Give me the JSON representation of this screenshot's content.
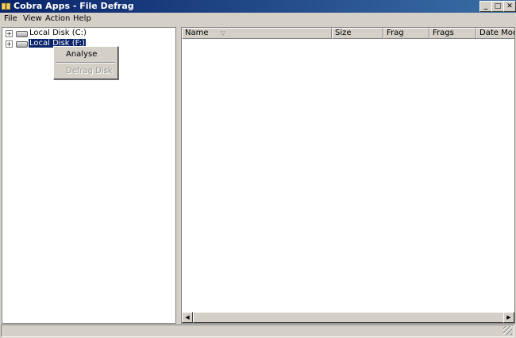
{
  "window": {
    "title": "Cobra Apps - File Defrag",
    "icon": "app-folder-icon",
    "controls": {
      "minimize": "_",
      "maximize": "□",
      "close": "✕"
    }
  },
  "menubar": {
    "items": [
      "File",
      "View",
      "Action",
      "Help"
    ]
  },
  "tree": {
    "items": [
      {
        "expander": "+",
        "icon": "drive-icon",
        "label": "Local Disk (C:)",
        "selected": false
      },
      {
        "expander": "+",
        "icon": "drive-icon",
        "label": "Local Disk (F:)",
        "selected": true
      }
    ]
  },
  "context_menu": {
    "items": [
      {
        "label": "Analyse",
        "enabled": true
      },
      {
        "label": "Defrag Disk",
        "enabled": false
      }
    ]
  },
  "list": {
    "columns": [
      "Name",
      "Size",
      "Frag",
      "Frags",
      "Date Modifi"
    ],
    "sort_icon": "▽",
    "rows": []
  },
  "scrollbar": {
    "left_arrow": "◀",
    "right_arrow": "▶"
  }
}
